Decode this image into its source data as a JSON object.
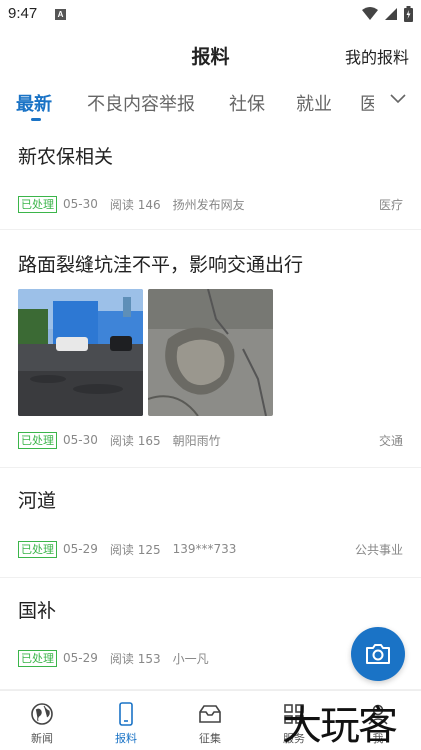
{
  "status_bar": {
    "time": "9:47",
    "notice": "A"
  },
  "header": {
    "title": "报料",
    "my_reports": "我的报料"
  },
  "tabs": [
    {
      "label": "最新"
    },
    {
      "label": "不良内容举报"
    },
    {
      "label": "社保"
    },
    {
      "label": "就业"
    },
    {
      "label": "医"
    }
  ],
  "items": [
    {
      "title": "新农保相关",
      "status": "已处理",
      "date": "05-30",
      "reads": "阅读 146",
      "author": "扬州发布网友",
      "category": "医疗"
    },
    {
      "title": "路面裂缝坑洼不平，影响交通出行",
      "status": "已处理",
      "date": "05-30",
      "reads": "阅读 165",
      "author": "朝阳雨竹",
      "category": "交通"
    },
    {
      "title": "河道",
      "status": "已处理",
      "date": "05-29",
      "reads": "阅读 125",
      "author": "139***733",
      "category": "公共事业"
    },
    {
      "title": "国补",
      "status": "已处理",
      "date": "05-29",
      "reads": "阅读 153",
      "author": "小一凡",
      "category": ""
    }
  ],
  "bottom_nav": [
    {
      "label": "新闻",
      "icon": "globe-icon"
    },
    {
      "label": "报料",
      "icon": "phone-icon"
    },
    {
      "label": "征集",
      "icon": "inbox-icon"
    },
    {
      "label": "服务",
      "icon": "grid-icon"
    },
    {
      "label": "我",
      "icon": "person-icon"
    }
  ],
  "watermark": "大玩客",
  "colors": {
    "accent": "#1a73c6",
    "status_green": "#3bb54a"
  }
}
